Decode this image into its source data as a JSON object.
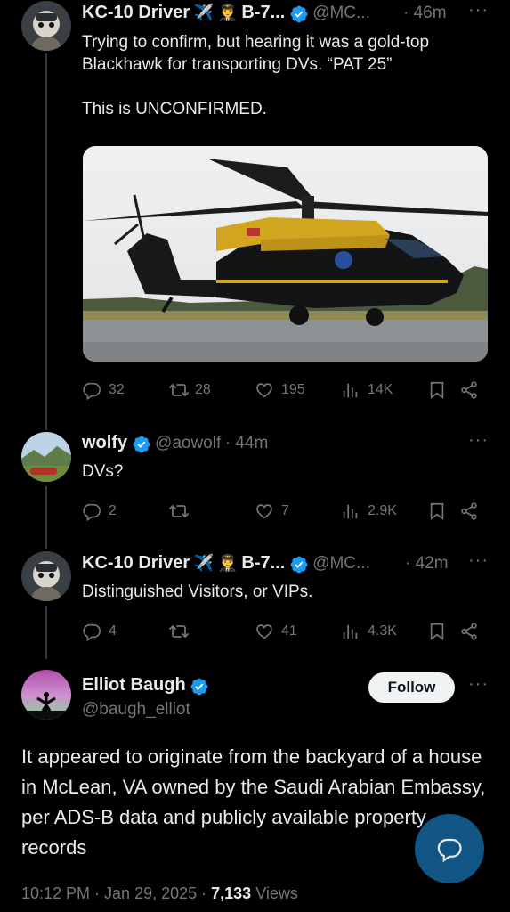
{
  "colors": {
    "background": "#000000",
    "text": "#e7e9ea",
    "muted": "#71767b",
    "verified": "#1d9bf0",
    "thread_line": "#333639"
  },
  "tweets": [
    {
      "name": "KC-10 Driver",
      "emoji1": "✈️",
      "emoji2": "👨‍✈️",
      "name_suffix": "B-7...",
      "handle": "@MC...",
      "time": "· 46m",
      "text": "Trying to confirm, but hearing it was a gold-top Blackhawk for transporting DVs. “PAT 25”\n\nThis is UNCONFIRMED.",
      "replies": "32",
      "reposts": "28",
      "likes": "195",
      "views": "14K",
      "has_media": true
    },
    {
      "name": "wolfy",
      "handle": "@aowolf",
      "time": "· 44m",
      "text": "DVs?",
      "replies": "2",
      "reposts": "",
      "likes": "7",
      "views": "2.9K"
    },
    {
      "name": "KC-10 Driver",
      "emoji1": "✈️",
      "emoji2": "👨‍✈️",
      "name_suffix": "B-7...",
      "handle": "@MC...",
      "time": "· 42m",
      "text": "Distinguished Visitors, or VIPs.",
      "replies": "4",
      "reposts": "",
      "likes": "41",
      "views": "4.3K"
    }
  ],
  "main": {
    "name": "Elliot Baugh",
    "handle": "@baugh_elliot",
    "follow_label": "Follow",
    "text": "It appeared to originate from the backyard of a house in McLean, VA owned by the Saudi Arabian Embassy, per ADS-B data and publicly available property records",
    "time": "10:12 PM · Jan 29, 2025 · ",
    "views_count": "7,133",
    "views_label": " Views"
  },
  "icons": {
    "reply": "reply-icon",
    "repost": "repost-icon",
    "like": "heart-icon",
    "views": "views-icon",
    "bookmark": "bookmark-icon",
    "share": "share-icon",
    "more": "more-icon",
    "verified": "verified-badge-icon",
    "compose": "compose-reply-icon"
  }
}
